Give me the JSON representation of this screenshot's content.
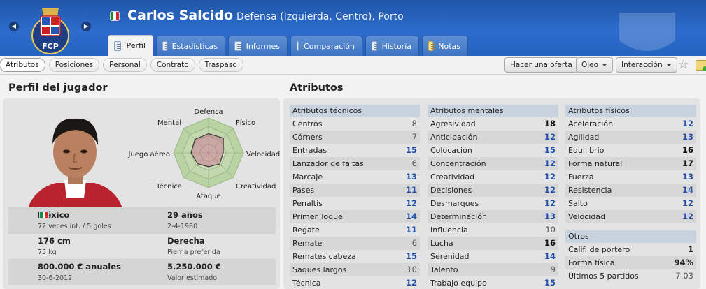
{
  "header": {
    "name": "Carlos Salcido",
    "role": "Defensa (Izquierda, Centro), Porto",
    "club_crest_text": "FCP",
    "prev_icon": "chevron-left-icon",
    "next_icon": "chevron-right-icon",
    "tabs": [
      {
        "label": "Perfil",
        "icon": "profile-icon",
        "active": true
      },
      {
        "label": "Estadísticas",
        "icon": "stats-icon"
      },
      {
        "label": "Informes",
        "icon": "report-icon"
      },
      {
        "label": "Comparación",
        "icon": "compare-icon"
      },
      {
        "label": "Historia",
        "icon": "history-icon"
      },
      {
        "label": "Notas",
        "icon": "notes-icon"
      }
    ]
  },
  "toolbar": {
    "subtabs": [
      {
        "label": "Atributos",
        "active": true
      },
      {
        "label": "Posiciones"
      },
      {
        "label": "Personal"
      },
      {
        "label": "Contrato"
      },
      {
        "label": "Traspaso"
      }
    ],
    "offer_button": "Hacer una oferta",
    "scout_button": "Ojeo",
    "interaction_button": "Interacción"
  },
  "profile": {
    "title": "Perfil del jugador",
    "radar_labels": {
      "defensa": "Defensa",
      "fisico": "Físico",
      "velocidad": "Velocidad",
      "creatividad": "Creatividad",
      "ataque": "Ataque",
      "tecnica": "Técnica",
      "juego_aereo": "Juego aéreo",
      "mental": "Mental"
    },
    "radar_values": {
      "defensa": 0.55,
      "fisico": 0.6,
      "velocidad": 0.42,
      "creatividad": 0.45,
      "ataque": 0.4,
      "tecnica": 0.44,
      "juego_aereo": 0.5,
      "mental": 0.55
    },
    "info": [
      {
        "main": "México",
        "sub": "72 veces int. / 5 goles"
      },
      {
        "main": "29 años",
        "sub": "2-4-1980"
      },
      {
        "main": "176 cm",
        "sub": "75 kg"
      },
      {
        "main": "Derecha",
        "sub": "Pierna preferida"
      },
      {
        "main": "800.000 € anuales",
        "sub": "30-6-2012"
      },
      {
        "main": "5.250.000 €",
        "sub": "Valor estimado"
      }
    ]
  },
  "attributes": {
    "title": "Atributos",
    "technical": {
      "header": "Atributos técnicos",
      "rows": [
        {
          "name": "Centros",
          "value": "8"
        },
        {
          "name": "Córners",
          "value": "7"
        },
        {
          "name": "Entradas",
          "value": "15"
        },
        {
          "name": "Lanzador de faltas",
          "value": "6"
        },
        {
          "name": "Marcaje",
          "value": "13"
        },
        {
          "name": "Pases",
          "value": "11"
        },
        {
          "name": "Penaltis",
          "value": "12"
        },
        {
          "name": "Primer Toque",
          "value": "14"
        },
        {
          "name": "Regate",
          "value": "11"
        },
        {
          "name": "Remate",
          "value": "6"
        },
        {
          "name": "Remates cabeza",
          "value": "15"
        },
        {
          "name": "Saques largos",
          "value": "10"
        },
        {
          "name": "Técnica",
          "value": "12"
        }
      ]
    },
    "mental": {
      "header": "Atributos mentales",
      "rows": [
        {
          "name": "Agresividad",
          "value": "18"
        },
        {
          "name": "Anticipación",
          "value": "12"
        },
        {
          "name": "Colocación",
          "value": "15"
        },
        {
          "name": "Concentración",
          "value": "12"
        },
        {
          "name": "Creatividad",
          "value": "12"
        },
        {
          "name": "Decisiones",
          "value": "12"
        },
        {
          "name": "Desmarques",
          "value": "12"
        },
        {
          "name": "Determinación",
          "value": "13"
        },
        {
          "name": "Influencia",
          "value": "10"
        },
        {
          "name": "Lucha",
          "value": "16"
        },
        {
          "name": "Serenidad",
          "value": "14"
        },
        {
          "name": "Talento",
          "value": "9"
        },
        {
          "name": "Trabajo equipo",
          "value": "15"
        }
      ]
    },
    "physical": {
      "header": "Atributos físicos",
      "rows": [
        {
          "name": "Aceleración",
          "value": "12"
        },
        {
          "name": "Agilidad",
          "value": "13"
        },
        {
          "name": "Equilibrio",
          "value": "16"
        },
        {
          "name": "Forma natural",
          "value": "17"
        },
        {
          "name": "Fuerza",
          "value": "13"
        },
        {
          "name": "Resistencia",
          "value": "14"
        },
        {
          "name": "Salto",
          "value": "12"
        },
        {
          "name": "Velocidad",
          "value": "12"
        }
      ]
    },
    "others": {
      "header": "Otros",
      "rows": [
        {
          "name": "Calif. de portero",
          "value": "1"
        },
        {
          "name": "Forma física",
          "value": "94%"
        },
        {
          "name": "Últimos 5 partidos",
          "value": "7.03"
        }
      ]
    }
  }
}
